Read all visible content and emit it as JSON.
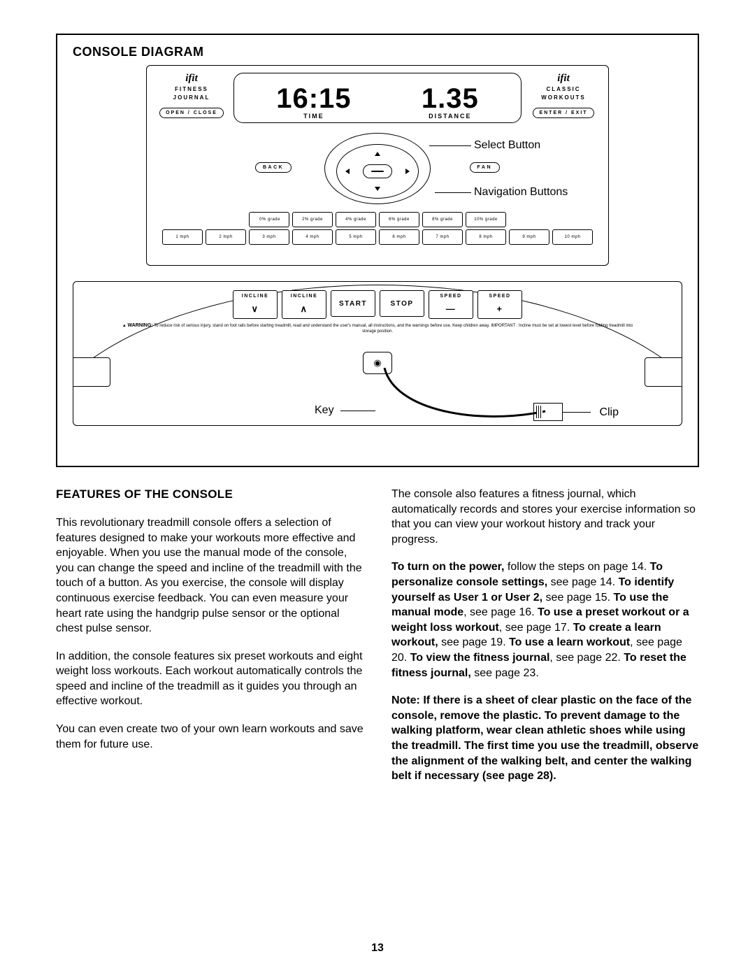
{
  "diagram_title": "CONSOLE DIAGRAM",
  "display": {
    "ifit_brand": "ifit",
    "left_panel": {
      "line1": "FITNESS",
      "line2": "JOURNAL",
      "button": "OPEN / CLOSE"
    },
    "right_panel": {
      "line1": "CLASSIC",
      "line2": "WORKOUTS",
      "button": "ENTER / EXIT"
    },
    "time_value": "16:15",
    "time_label": "TIME",
    "distance_value": "1.35",
    "distance_label": "DISTANCE"
  },
  "nav": {
    "back": "BACK",
    "fan": "FAN",
    "callout_select": "Select Button",
    "callout_nav": "Navigation Buttons"
  },
  "grade_buttons": [
    "0% grade",
    "2% grade",
    "4% grade",
    "6% grade",
    "8% grade",
    "10% grade"
  ],
  "mph_buttons": [
    "1 mph",
    "2 mph",
    "3 mph",
    "4 mph",
    "5 mph",
    "6 mph",
    "7 mph",
    "8 mph",
    "9 mph",
    "10 mph"
  ],
  "controls": {
    "incline_down": "INCLINE",
    "incline_up": "INCLINE",
    "start": "START",
    "stop": "STOP",
    "speed_down": "SPEED",
    "speed_up": "SPEED"
  },
  "warning_label": "WARNING:",
  "warning_text": "To reduce risk of serious injury, stand on foot rails before starting treadmill, read and understand the user's manual, all instructions, and the warnings before use. Keep children away.   IMPORTANT : Incline must be set at lowest level before folding treadmill into storage position.",
  "key_label": "Key",
  "clip_label": "Clip",
  "features_heading": "FEATURES OF THE CONSOLE",
  "para1": "This revolutionary treadmill console offers a selection of features designed to make your workouts more effective and enjoyable. When you use the manual mode of the console, you can change the speed and incline of the treadmill with the touch of a button. As you exercise, the console will display continuous exercise feedback. You can even measure your heart rate using the handgrip pulse sensor or the optional chest pulse sensor.",
  "para2": "In addition, the console features six preset workouts and eight weight loss workouts. Each workout automatically controls the speed and incline of the treadmill as it guides you through an effective workout.",
  "para3": "You can even create two of your own learn workouts and save them for future use.",
  "para4": "The console also features a fitness journal, which automatically records and stores your exercise information so that you can view your workout history and track your progress.",
  "instr": {
    "b1": "To turn on the power,",
    "t1": " follow the steps on page 14. ",
    "b2": "To personalize console settings,",
    "t2": " see page 14. ",
    "b3": "To identify yourself as User 1 or User 2,",
    "t3": " see page 15. ",
    "b4": "To use the manual mode",
    "t4": ", see page 16. ",
    "b5": "To use a preset workout or a weight loss workout",
    "t5": ", see page 17. ",
    "b6": "To create a learn workout,",
    "t6": " see page 19. ",
    "b7": "To use a learn workout",
    "t7": ", see page 20. ",
    "b8": "To view the fitness journal",
    "t8": ", see page 22. ",
    "b9": "To reset the fitness journal,",
    "t9": " see page 23."
  },
  "note": "Note: If there is a sheet of clear plastic on the face of the console, remove the plastic. To prevent damage to the walking platform, wear clean athletic shoes while using the treadmill. The first time you use the treadmill, observe the alignment of the walking belt, and center the walking belt if necessary (see page 28).",
  "page_number": "13"
}
